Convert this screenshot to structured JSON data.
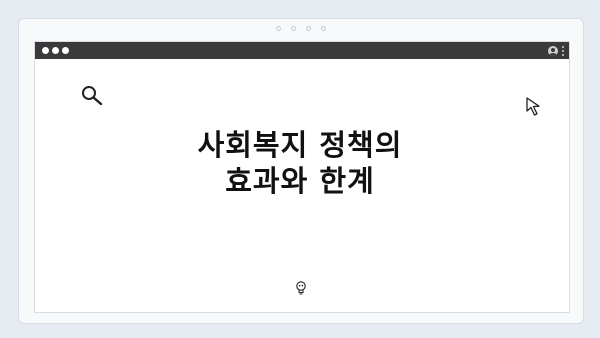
{
  "browser": {
    "title_bar_color": "#3a3a3a",
    "window_background": "#ffffff",
    "frame_background": "#f7f9fb",
    "page_background": "#e6ecf2"
  },
  "icons": {
    "window_controls": [
      "circle-icon",
      "circle-icon",
      "circle-icon"
    ],
    "titlebar_right": [
      "user-icon",
      "kebab-menu-icon"
    ],
    "top_left": "search-icon",
    "top_right": "cursor-arrow-icon",
    "bottom_center": "lightbulb-icon",
    "page_indicator": [
      "dot-icon",
      "dot-icon",
      "dot-icon",
      "dot-icon"
    ]
  },
  "content": {
    "headline_line1": "사회복지 정책의",
    "headline_line2": "효과와 한계"
  }
}
